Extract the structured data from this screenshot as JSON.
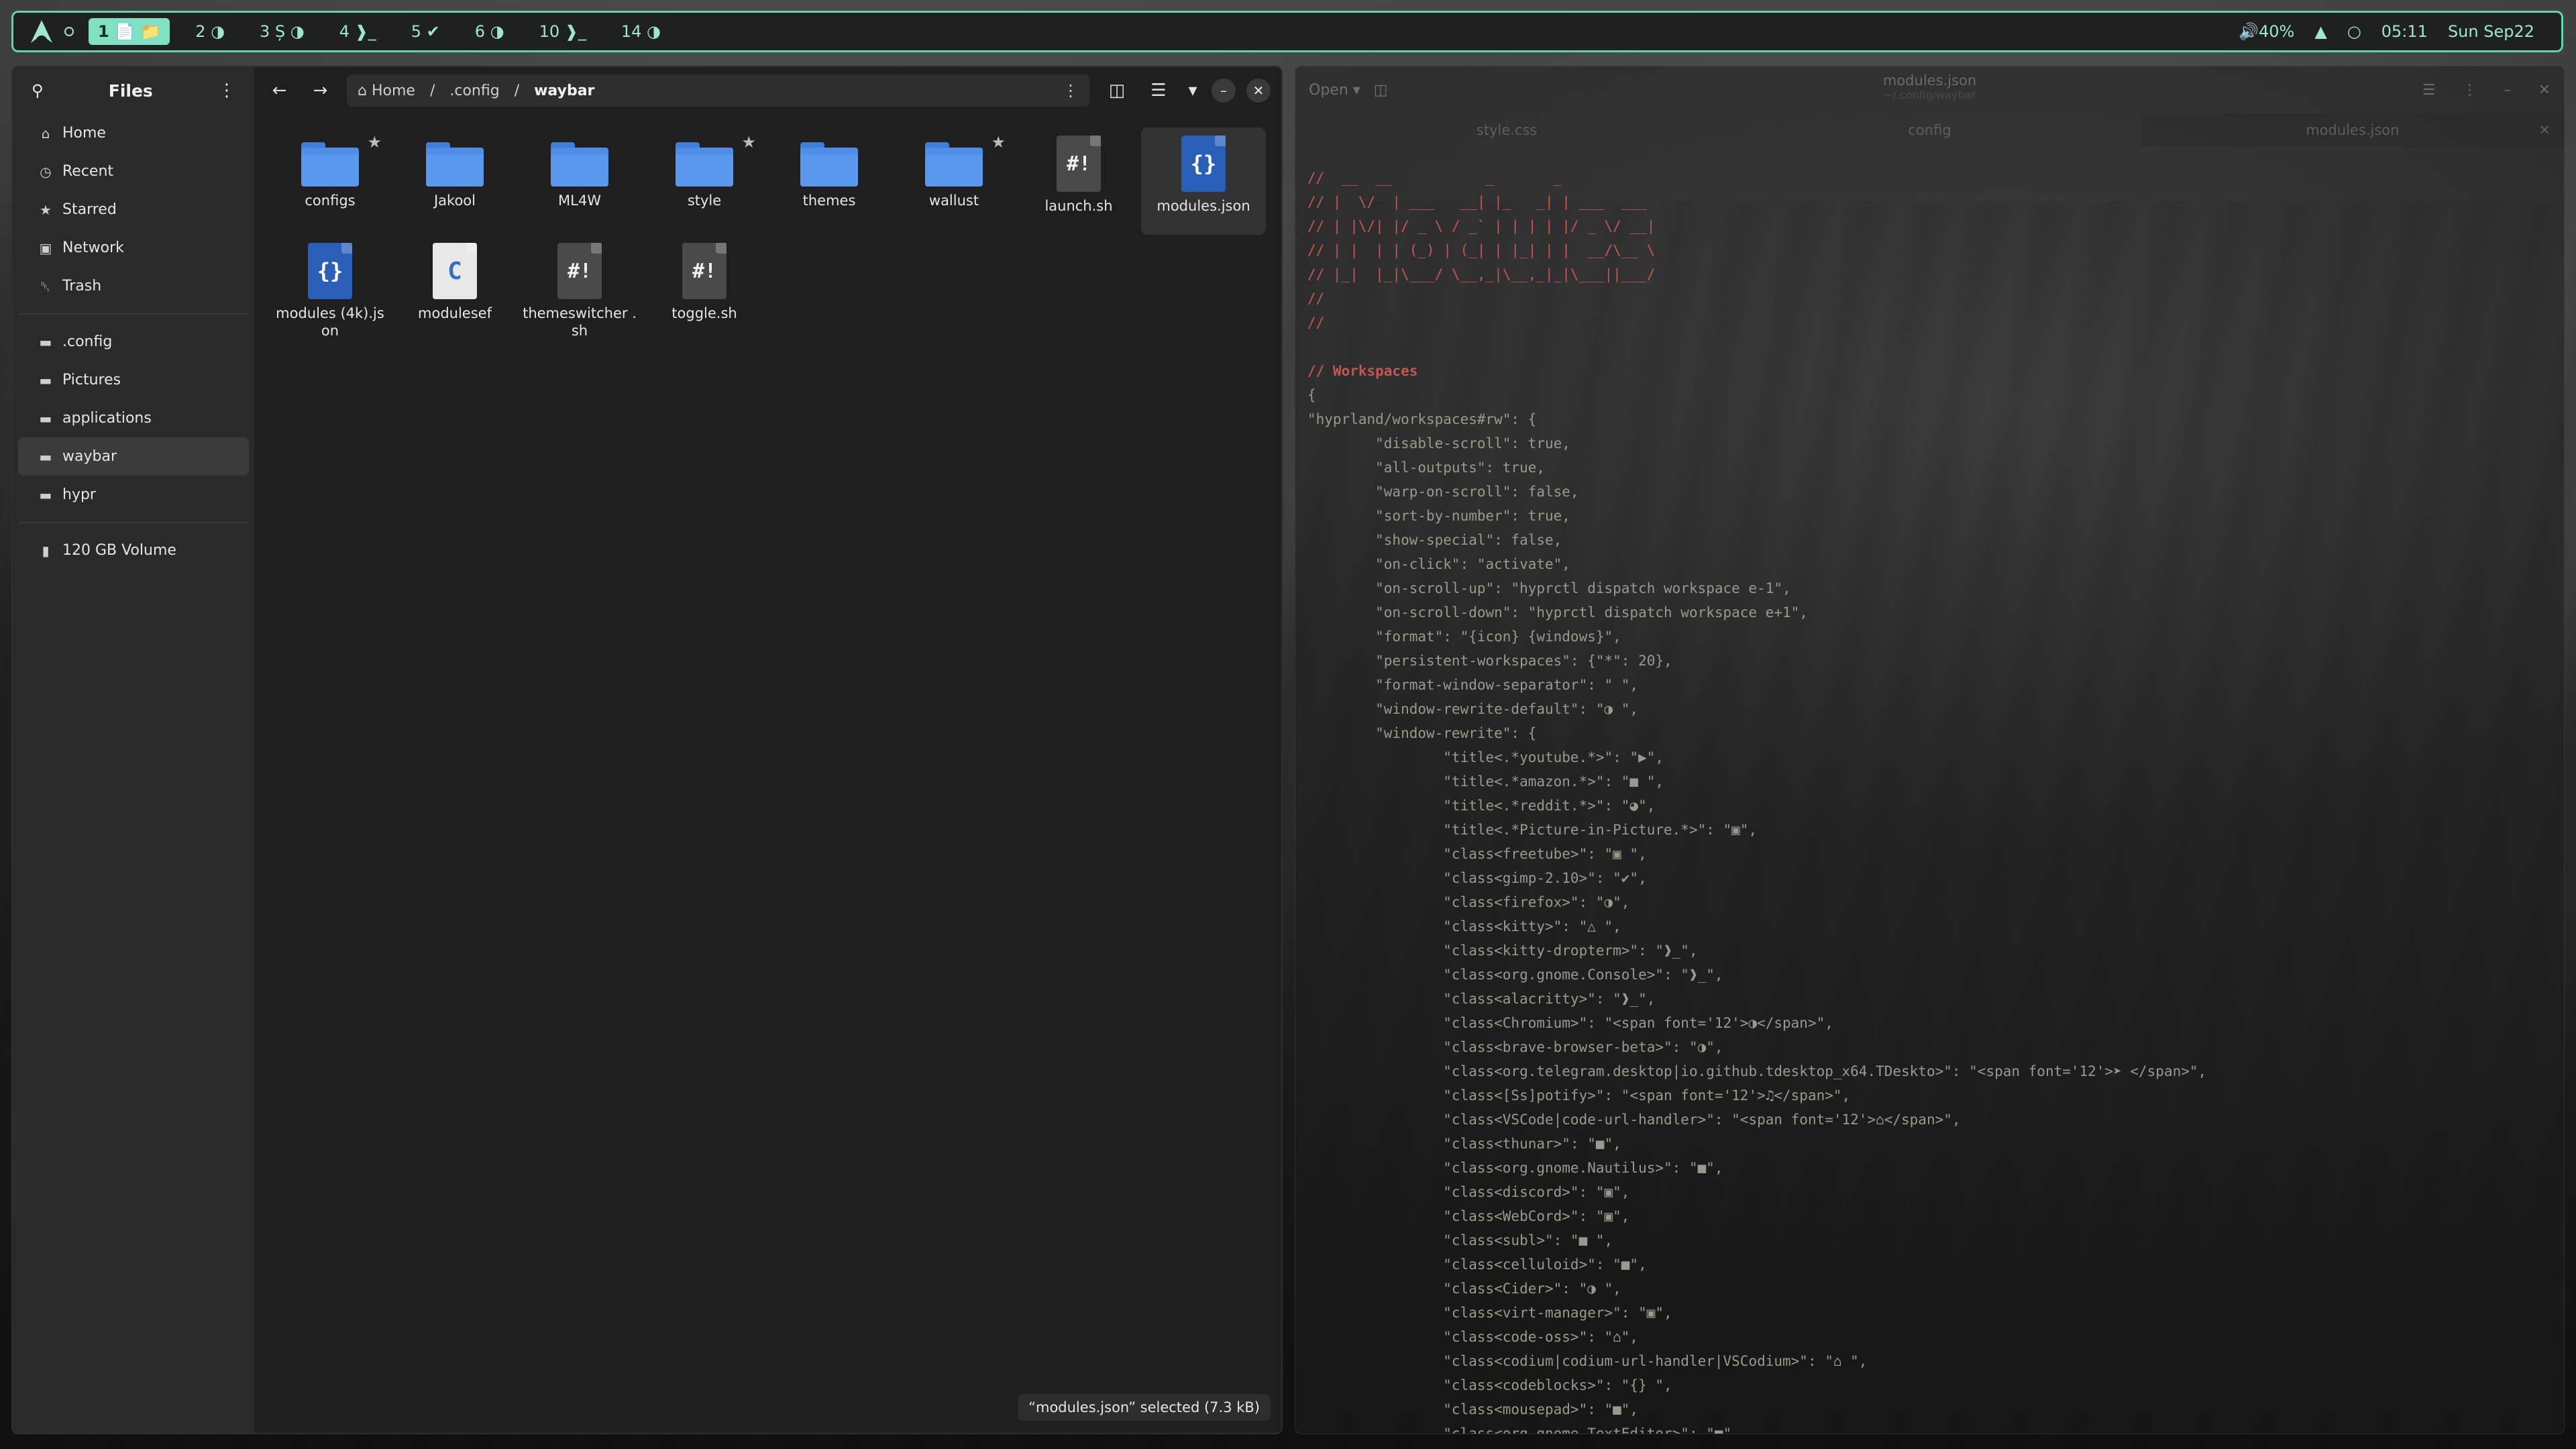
{
  "topbar": {
    "workspaces": [
      {
        "label": "1 📄 📁",
        "active": true
      },
      {
        "label": "2 ◑"
      },
      {
        "label": "3 Ș ◑"
      },
      {
        "label": "4 ❱_"
      },
      {
        "label": "5 ✔"
      },
      {
        "label": "6 ◑"
      },
      {
        "label": "10 ❱_"
      },
      {
        "label": "14 ◑"
      }
    ],
    "volume": "🔊40%",
    "time": "05:11",
    "date": "Sun Sep22",
    "accent": "#5fd3b4"
  },
  "files": {
    "title": "Files",
    "sidebar_top": [
      {
        "label": "Home",
        "icon": "home-icon",
        "glyph": "⌂"
      },
      {
        "label": "Recent",
        "icon": "clock-icon",
        "glyph": "◷"
      },
      {
        "label": "Starred",
        "icon": "star-icon",
        "glyph": "★"
      },
      {
        "label": "Network",
        "icon": "network-icon",
        "glyph": "▣"
      },
      {
        "label": "Trash",
        "icon": "trash-icon",
        "glyph": "␡"
      }
    ],
    "sidebar_bookmarks": [
      {
        "label": ".config",
        "selected": false
      },
      {
        "label": "Pictures",
        "selected": false
      },
      {
        "label": "applications",
        "selected": false
      },
      {
        "label": "waybar",
        "selected": true
      },
      {
        "label": "hypr",
        "selected": false
      }
    ],
    "volume_label": "120 GB Volume",
    "path": {
      "home": "Home",
      "sep": "/",
      "segment": ".config",
      "current": "waybar"
    },
    "items": [
      {
        "label": "configs",
        "type": "folder",
        "starred": true
      },
      {
        "label": "Jakool",
        "type": "folder",
        "starred": false
      },
      {
        "label": "ML4W",
        "type": "folder",
        "starred": false
      },
      {
        "label": "style",
        "type": "folder",
        "starred": true
      },
      {
        "label": "themes",
        "type": "folder",
        "starred": false
      },
      {
        "label": "wallust",
        "type": "folder",
        "starred": true
      },
      {
        "label": "launch.sh",
        "type": "sh",
        "starred": false
      },
      {
        "label": "modules.json",
        "type": "json",
        "starred": false,
        "selected": true
      },
      {
        "label": "modules (4k).json",
        "type": "json",
        "starred": false
      },
      {
        "label": "modulesef",
        "type": "c",
        "starred": false
      },
      {
        "label": "themeswitcher .sh",
        "type": "sh",
        "starred": false
      },
      {
        "label": "toggle.sh",
        "type": "sh",
        "starred": false
      }
    ],
    "status": "“modules.json” selected  (7.3 kB)"
  },
  "editor": {
    "open_label": "Open ▾",
    "title": "modules.json",
    "subtitle": "~/.config/waybar",
    "tabs": [
      "style.css",
      "config",
      "modules.json"
    ],
    "lines": [
      {
        "t": "//  __  __           _       _",
        "c": "cm"
      },
      {
        "t": "// |  \\/  | ___   __| |_   _| | ___  ___",
        "c": "cm"
      },
      {
        "t": "// | |\\/| |/ _ \\ / _` | | | | |/ _ \\/ __|",
        "c": "cm"
      },
      {
        "t": "// | |  | | (_) | (_| | |_| | |  __/\\__ \\",
        "c": "cm"
      },
      {
        "t": "// |_|  |_|\\___/ \\__,_|\\__,_|_|\\___||___/",
        "c": "cm"
      },
      {
        "t": "//",
        "c": "cm"
      },
      {
        "t": "//",
        "c": "cm"
      },
      {
        "t": "",
        "c": ""
      },
      {
        "t": "// Workspaces",
        "c": "cm bold"
      },
      {
        "t": "{",
        "c": ""
      },
      {
        "t": "\"hyprland/workspaces#rw\": {",
        "c": ""
      },
      {
        "t": "        \"disable-scroll\": true,",
        "c": ""
      },
      {
        "t": "        \"all-outputs\": true,",
        "c": ""
      },
      {
        "t": "        \"warp-on-scroll\": false,",
        "c": ""
      },
      {
        "t": "        \"sort-by-number\": true,",
        "c": ""
      },
      {
        "t": "        \"show-special\": false,",
        "c": ""
      },
      {
        "t": "        \"on-click\": \"activate\",",
        "c": ""
      },
      {
        "t": "        \"on-scroll-up\": \"hyprctl dispatch workspace e-1\",",
        "c": ""
      },
      {
        "t": "        \"on-scroll-down\": \"hyprctl dispatch workspace e+1\",",
        "c": ""
      },
      {
        "t": "        \"format\": \"{icon} {windows}\",",
        "c": ""
      },
      {
        "t": "        \"persistent-workspaces\": {\"*\": 20},",
        "c": ""
      },
      {
        "t": "        \"format-window-separator\": \" \",",
        "c": ""
      },
      {
        "t": "        \"window-rewrite-default\": \"◑ \",",
        "c": ""
      },
      {
        "t": "        \"window-rewrite\": {",
        "c": ""
      },
      {
        "t": "                \"title<.*youtube.*>\": \"▶\",",
        "c": ""
      },
      {
        "t": "                \"title<.*amazon.*>\": \"■ \",",
        "c": ""
      },
      {
        "t": "                \"title<.*reddit.*>\": \"◕\",",
        "c": ""
      },
      {
        "t": "                \"title<.*Picture-in-Picture.*>\": \"▣\",",
        "c": ""
      },
      {
        "t": "                \"class<freetube>\": \"▣ \",",
        "c": ""
      },
      {
        "t": "                \"class<gimp-2.10>\": \"✔\",",
        "c": ""
      },
      {
        "t": "                \"class<firefox>\": \"◑\",",
        "c": ""
      },
      {
        "t": "                \"class<kitty>\": \"△ \",",
        "c": ""
      },
      {
        "t": "                \"class<kitty-dropterm>\": \"❱_\",",
        "c": ""
      },
      {
        "t": "                \"class<org.gnome.Console>\": \"❱_\",",
        "c": ""
      },
      {
        "t": "                \"class<alacritty>\": \"❱_\",",
        "c": ""
      },
      {
        "t": "                \"class<Chromium>\": \"<span font='12'>◑</span>\",",
        "c": ""
      },
      {
        "t": "                \"class<brave-browser-beta>\": \"◑\",",
        "c": ""
      },
      {
        "t": "                \"class<org.telegram.desktop|io.github.tdesktop_x64.TDeskto>\": \"<span font='12'>➤ </span>\",",
        "c": ""
      },
      {
        "t": "                \"class<[Ss]potify>\": \"<span font='12'>♫</span>\",",
        "c": ""
      },
      {
        "t": "                \"class<VSCode|code-url-handler>\": \"<span font='12'>⌂</span>\",",
        "c": ""
      },
      {
        "t": "                \"class<thunar>\": \"■\",",
        "c": ""
      },
      {
        "t": "                \"class<org.gnome.Nautilus>\": \"■\",",
        "c": ""
      },
      {
        "t": "                \"class<discord>\": \"▣\",",
        "c": ""
      },
      {
        "t": "                \"class<WebCord>\": \"▣\",",
        "c": ""
      },
      {
        "t": "                \"class<subl>\": \"■ \",",
        "c": ""
      },
      {
        "t": "                \"class<celluloid>\": \"■\",",
        "c": ""
      },
      {
        "t": "                \"class<Cider>\": \"◑ \",",
        "c": ""
      },
      {
        "t": "                \"class<virt-manager>\": \"▣\",",
        "c": ""
      },
      {
        "t": "                \"class<code-oss>\": \"⌂\",",
        "c": ""
      },
      {
        "t": "                \"class<codium|codium-url-handler|VSCodium>\": \"⌂ \",",
        "c": ""
      },
      {
        "t": "                \"class<codeblocks>\": \"{} \",",
        "c": ""
      },
      {
        "t": "                \"class<mousepad>\": \"■\",",
        "c": ""
      },
      {
        "t": "                \"class<org.gnome.TextEditor>\": \"■\",",
        "c": ""
      }
    ]
  }
}
